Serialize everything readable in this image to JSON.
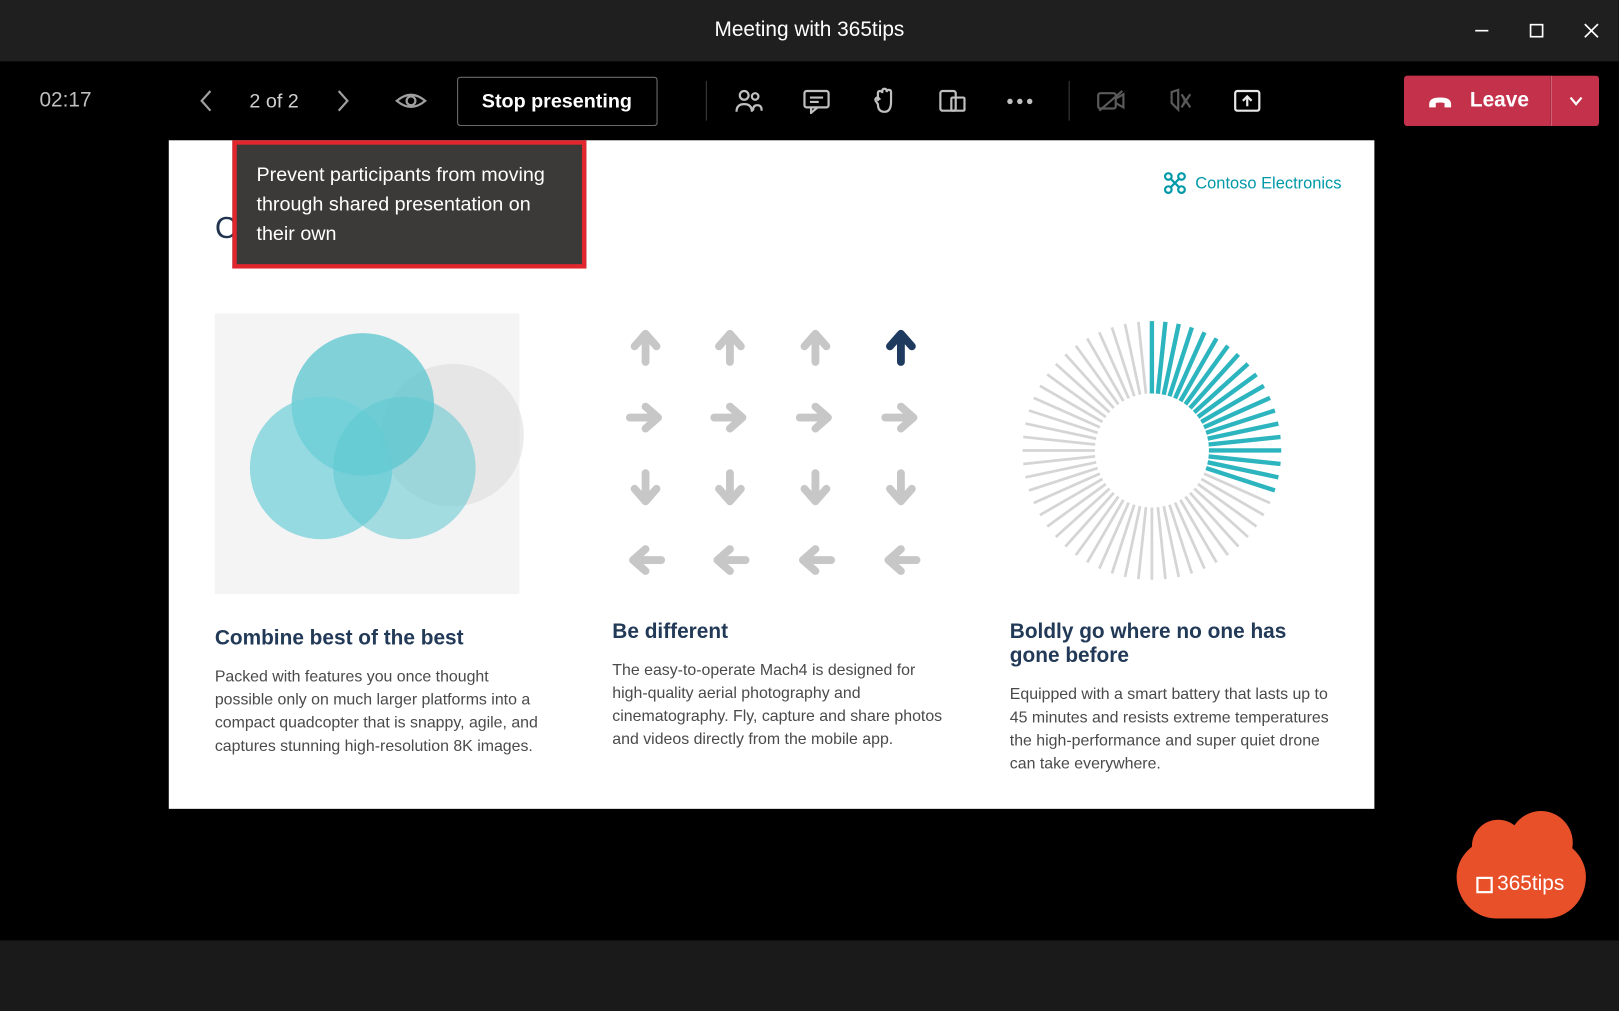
{
  "window": {
    "title": "Meeting with 365tips"
  },
  "toolbar": {
    "timer": "02:17",
    "slide_counter": "2 of 2",
    "stop_presenting": "Stop presenting",
    "leave": "Leave"
  },
  "tooltip": {
    "text": "Prevent participants from moving through shared presentation on their own"
  },
  "slide": {
    "title_fragment": "C",
    "brand": "Contoso Electronics",
    "columns": [
      {
        "heading": "Combine best of the best",
        "body": "Packed with features you once thought possible only on much larger platforms into a compact quadcopter that is snappy, agile, and captures stunning high-resolution 8K images."
      },
      {
        "heading": "Be different",
        "body": "The easy-to-operate Mach4 is designed for high-quality aerial photography and cinematography. Fly, capture and share photos and videos directly from the mobile app."
      },
      {
        "heading": "Boldly go where no one has gone before",
        "body": "Equipped with a smart battery that lasts up to 45 minutes and resists extreme temperatures the high-performance and super quiet drone can take everywhere."
      }
    ]
  },
  "watermark": {
    "label": "365tips"
  }
}
